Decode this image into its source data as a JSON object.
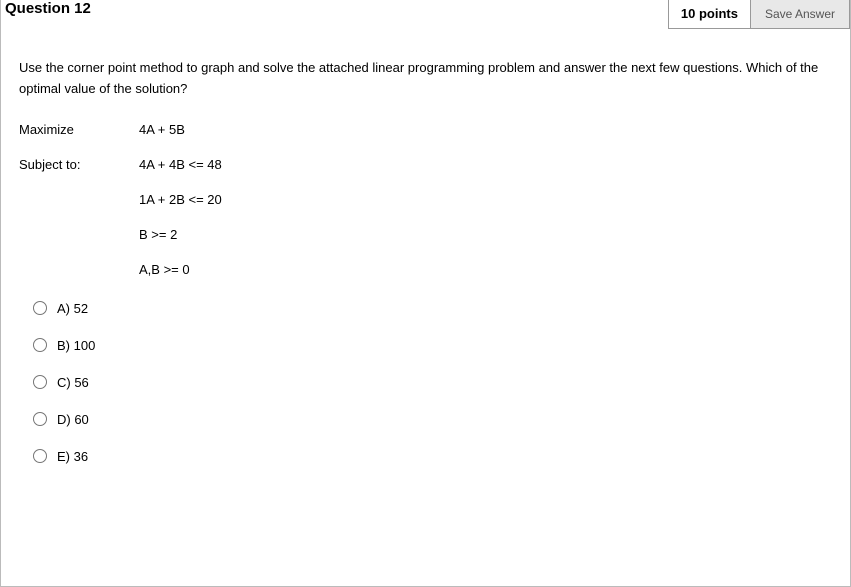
{
  "header": {
    "title": "Question 12",
    "points": "10 points",
    "save_label": "Save Answer"
  },
  "prompt": "Use the corner point method to graph and solve the attached linear programming problem and answer the next few questions. Which of the optimal value of the solution?",
  "lp": {
    "maximize_label": "Maximize",
    "maximize_expr": "4A + 5B",
    "subject_label": "Subject to:",
    "constraints": [
      "4A + 4B <= 48",
      "1A + 2B <= 20",
      "B >= 2",
      "A,B >= 0"
    ]
  },
  "options": [
    {
      "label": "A) 52"
    },
    {
      "label": "B) 100"
    },
    {
      "label": "C) 56"
    },
    {
      "label": "D) 60"
    },
    {
      "label": "E) 36"
    }
  ]
}
